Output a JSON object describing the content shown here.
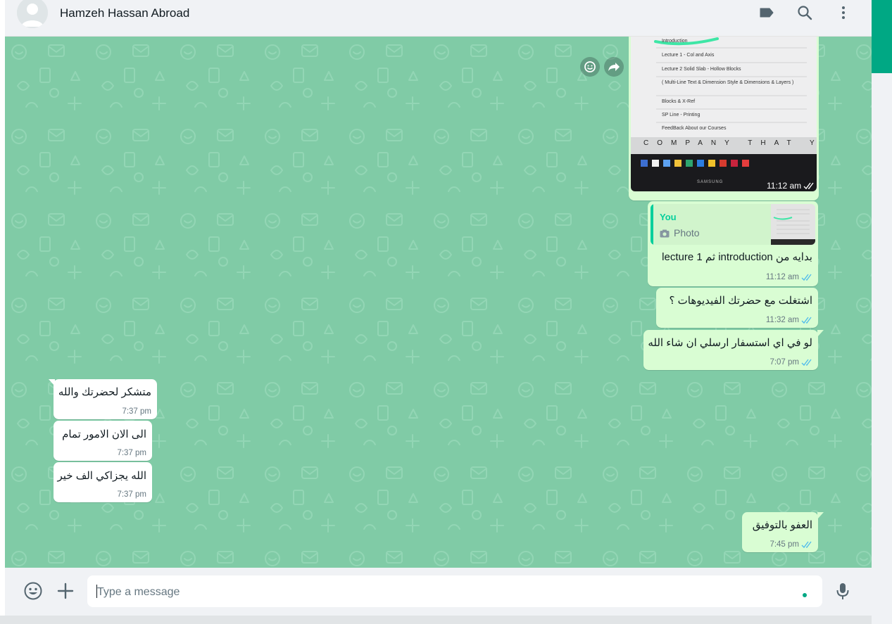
{
  "header": {
    "contact_name": "Hamzeh Hassan Abroad",
    "icons": [
      "label-icon",
      "search-icon",
      "menu-icon"
    ]
  },
  "photo_message": {
    "lines": [
      "Introduction",
      "Lecture 1 - Col and Axis",
      "Lecture 2 Solid Slab - Hollow Blocks",
      "( Multi-Line Text & Dimension Style & Dimensions & Layers )",
      "Blocks & X-Ref",
      "SP Line - Printing",
      "FeedBack About our Courses"
    ],
    "banner": "COMPANY THAT YOU",
    "brand": "SAMSUNG",
    "time": "11:12 am"
  },
  "messages": [
    {
      "id": "reply",
      "quote_author": "You",
      "quote_label": "Photo",
      "text": "بدايه من introduction ثم lecture 1",
      "time": "11:12 am"
    },
    {
      "id": "m2",
      "text": "اشتغلت مع حضرتك الفيديوهات ؟",
      "time": "11:32 am"
    },
    {
      "id": "m3",
      "text": "لو في اي استسفار ارسلي ان شاء الله",
      "time": "7:07 pm"
    },
    {
      "id": "m4",
      "text": "متشكر لحضرتك والله",
      "time": "7:37 pm"
    },
    {
      "id": "m5",
      "text": "الى الان الامور تمام",
      "time": "7:37 pm"
    },
    {
      "id": "m6",
      "text": "الله يجزاكي الف خير",
      "time": "7:37 pm"
    },
    {
      "id": "m7",
      "text": "العفو بالتوفيق",
      "time": "7:45 pm"
    }
  ],
  "composer": {
    "placeholder": "Type a message"
  },
  "colors": {
    "chat_background": "#80cba6",
    "outgoing_bubble": "#d9fdd3",
    "incoming_bubble": "#ffffff",
    "accent": "#00a884",
    "tick_blue": "#53bdeb"
  }
}
